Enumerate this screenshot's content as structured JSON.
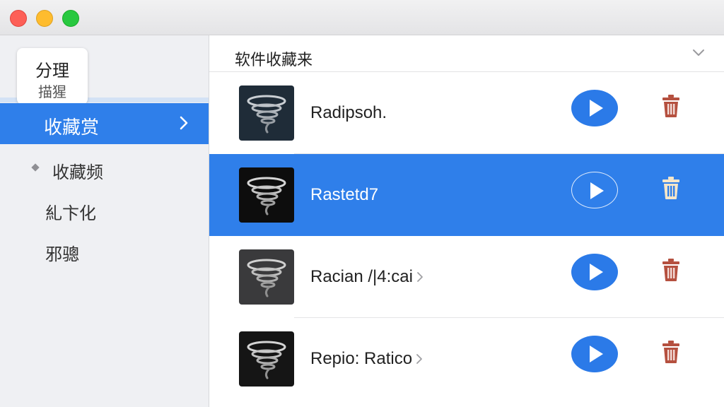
{
  "window": {
    "buttons": {
      "close": "close-button",
      "minimize": "minimize-button",
      "maximize": "maximize-button"
    }
  },
  "sidebar": {
    "card": {
      "title": "分理",
      "subtitle": "描猩"
    },
    "items": [
      {
        "label": "收藏赏",
        "active": true
      },
      {
        "label": "收藏频",
        "active": false
      },
      {
        "label": "糺卞化",
        "active": false
      },
      {
        "label": "邪骢",
        "active": false
      }
    ]
  },
  "main": {
    "header": {
      "title": "软件收藏来"
    },
    "rows": [
      {
        "label": "Radipsoh.",
        "selected": false,
        "thumb_bg": "#1f2c38",
        "has_chevron": false
      },
      {
        "label": "Rastetd7",
        "selected": true,
        "thumb_bg": "#0d0d0d",
        "has_chevron": false
      },
      {
        "label": "Racian  /|4:cai",
        "selected": false,
        "thumb_bg": "#3a3a3c",
        "has_chevron": true
      },
      {
        "label": "Repio: Ratico",
        "selected": false,
        "thumb_bg": "#151515",
        "has_chevron": true
      }
    ]
  },
  "colors": {
    "accent": "#2f7fea",
    "play_button": "#2b7ae8",
    "trash_icon": "#b5503f",
    "sidebar_bg": "#eff0f3"
  },
  "icons": {
    "sidebar_active": "chevron-right-icon",
    "sidebar_bullet": "diamond-bullet-icon",
    "header": "chevron-down-icon",
    "row_thumb": "tornado-icon",
    "row_play": "play-icon",
    "row_delete": "trash-icon"
  }
}
